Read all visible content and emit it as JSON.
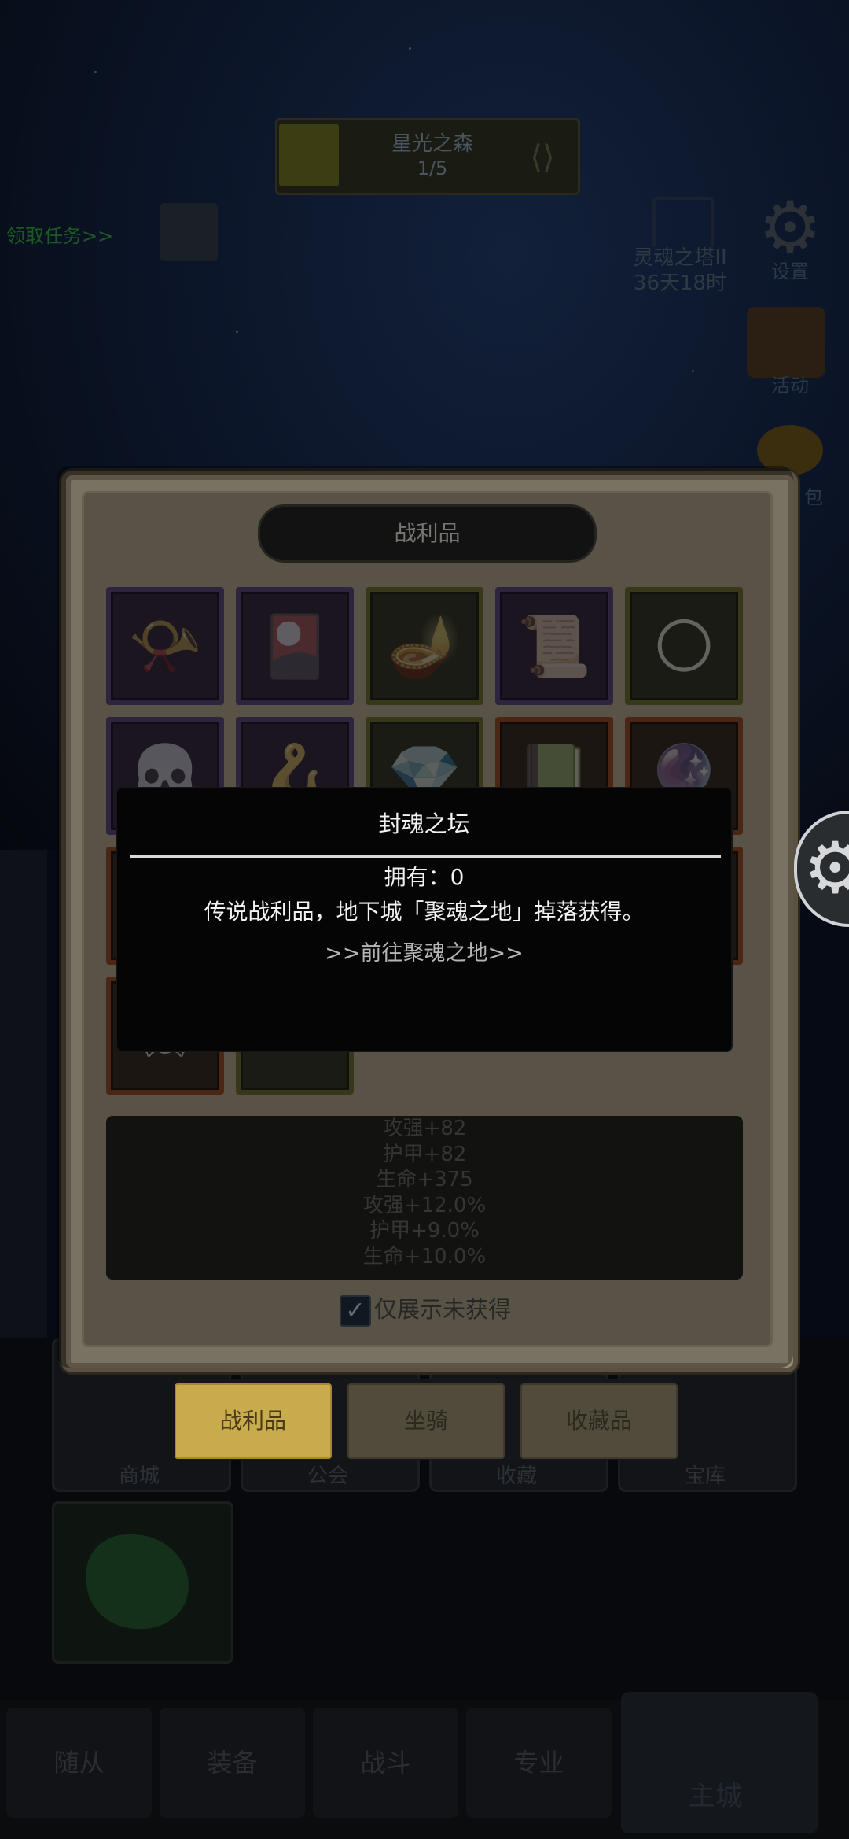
{
  "background": {
    "map": {
      "name": "星光之森",
      "progress": "1/5"
    },
    "quest_link": "领取任务>>",
    "tower": {
      "name": "灵魂之塔II",
      "timer": "36天18时"
    },
    "side_buttons": [
      {
        "label": "设置",
        "icon": "gear-icon"
      },
      {
        "label": "活动",
        "icon": "scroll-icon"
      },
      {
        "label": "包",
        "icon": "coin-bag-icon"
      }
    ],
    "bottom_cards": [
      "商城",
      "公会",
      "收藏",
      "宝库"
    ],
    "nav": [
      "随从",
      "装备",
      "战斗",
      "专业"
    ],
    "nav_main": "主城"
  },
  "panel": {
    "title": "战利品",
    "grid": [
      {
        "icon": "horn-icon",
        "glyph": "📯",
        "rarity": "purple"
      },
      {
        "icon": "purple-cloth-icon",
        "glyph": "🎴",
        "rarity": "purple"
      },
      {
        "icon": "magic-lamp-icon",
        "glyph": "🪔",
        "rarity": "gold"
      },
      {
        "icon": "rune-book-icon",
        "glyph": "📜",
        "rarity": "purple"
      },
      {
        "icon": "golden-orb-icon",
        "glyph": "🌕",
        "rarity": "gold"
      },
      {
        "icon": "skull-icon",
        "glyph": "💀",
        "rarity": "purple"
      },
      {
        "icon": "hook-icon",
        "glyph": "🪝",
        "rarity": "purple"
      },
      {
        "icon": "crystal-icon",
        "glyph": "💎",
        "rarity": "gold"
      },
      {
        "icon": "green-scroll-icon",
        "glyph": "📗",
        "rarity": "orange"
      },
      {
        "icon": "amulet-icon",
        "glyph": "🔮",
        "rarity": "orange"
      },
      {
        "icon": "relic-icon",
        "glyph": "🏺",
        "rarity": "orange"
      },
      {
        "icon": "blank-slot",
        "glyph": "",
        "rarity": "orange"
      },
      {
        "icon": "blank-slot",
        "glyph": "",
        "rarity": "orange"
      },
      {
        "icon": "blank-slot",
        "glyph": "",
        "rarity": "orange"
      },
      {
        "icon": "blank-slot",
        "glyph": "",
        "rarity": "orange"
      },
      {
        "icon": "demon-skull-icon",
        "glyph": "☠",
        "rarity": "orange"
      },
      {
        "icon": "dark-orb-icon",
        "glyph": "⚫",
        "rarity": "gold"
      }
    ],
    "stats": [
      "攻强+82",
      "护甲+82",
      "生命+375",
      "攻强+12.0%",
      "护甲+9.0%",
      "生命+10.0%"
    ],
    "filter_label": "仅展示未获得",
    "filter_checked": true,
    "tabs": [
      "战利品",
      "坐骑",
      "收藏品"
    ],
    "active_tab": 0
  },
  "popup": {
    "title": "封魂之坛",
    "owned": "拥有：0",
    "description": "传说战利品，地下城「聚魂之地」掉落获得。",
    "link": ">>前往聚魂之地>>"
  },
  "colors": {
    "panel_bg": "#c4b9a1",
    "popup_bg": "#050505",
    "rarity_purple": "#4c3b64",
    "rarity_gold": "#5a5b2a",
    "rarity_orange": "#7a3e22",
    "active_tab": "#c7ab4c"
  }
}
